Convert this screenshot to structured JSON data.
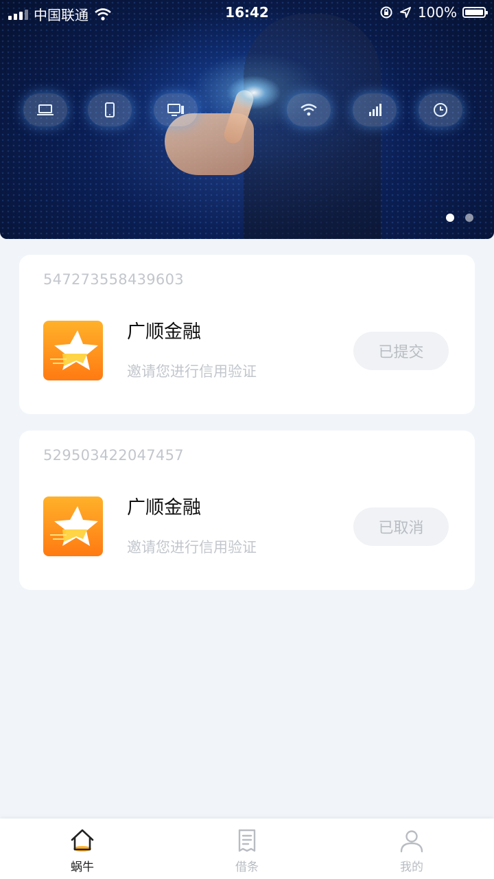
{
  "status_bar": {
    "carrier": "中国联通",
    "time": "16:42",
    "battery": "100%"
  },
  "banner": {
    "pager_total": 2,
    "pager_active": 0,
    "device_icons": [
      "laptop-icon",
      "tablet-icon",
      "desktop-icon",
      "wifi-icon",
      "signal-icon",
      "clock-icon"
    ]
  },
  "orders": [
    {
      "order_no": "547273558439603",
      "name": "广顺金融",
      "desc": "邀请您进行信用验证",
      "status": "已提交"
    },
    {
      "order_no": "529503422047457",
      "name": "广顺金融",
      "desc": "邀请您进行信用验证",
      "status": "已取消"
    }
  ],
  "tabbar": {
    "tabs": [
      {
        "label": "蜗牛",
        "icon": "home-icon",
        "active": true
      },
      {
        "label": "借条",
        "icon": "document-icon",
        "active": false
      },
      {
        "label": "我的",
        "icon": "user-icon",
        "active": false
      }
    ]
  },
  "colors": {
    "accent": "#ff8a1a",
    "muted_text": "#c2c6cc",
    "page_bg": "#f1f5f9"
  }
}
